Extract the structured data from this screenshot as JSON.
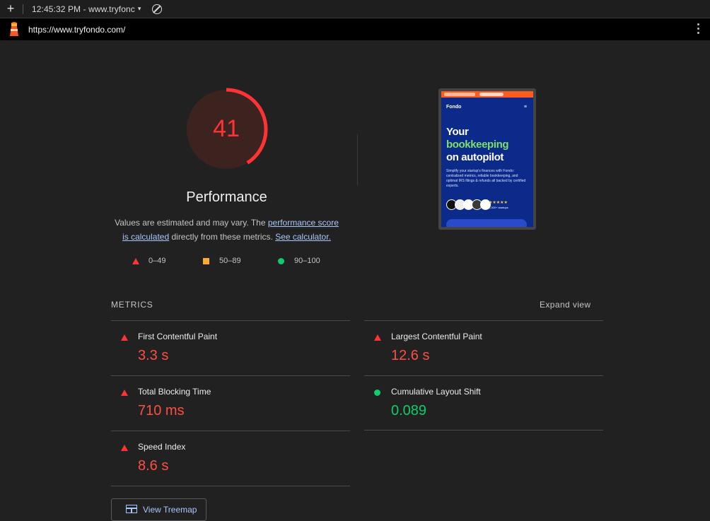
{
  "browser": {
    "new_tab_glyph": "+",
    "tab_title": "12:45:32 PM - www.tryfonc",
    "tab_menu_glyph": "▾",
    "url": "https://www.tryfondo.com/"
  },
  "report": {
    "score": "41",
    "score_fraction": 0.41,
    "category_title": "Performance",
    "description": {
      "prefix": "Values are estimated and may vary. The ",
      "link1": "performance score is calculated",
      "middle": " directly from these metrics. ",
      "link2": "See calculator."
    },
    "legend": [
      {
        "label": "0–49",
        "shape": "triangle",
        "color": "#ff3333"
      },
      {
        "label": "50–89",
        "shape": "square",
        "color": "#ffaa33"
      },
      {
        "label": "90–100",
        "shape": "circle",
        "color": "#0cce6b"
      }
    ],
    "colors": {
      "fail": "#ff4e42",
      "pass": "#0cce6b",
      "link": "#a8c7fa"
    }
  },
  "screenshot": {
    "brand": "Fondo",
    "menu_glyph": "≡",
    "headline_1": "Your",
    "headline_2": "bookkeeping",
    "headline_3": "on autopilot",
    "subtext": "Simplify your startup's finances with Fondo: centralized metrics, reliable bookkeeping, and optimal IRS filings & refunds all backed by certified experts.",
    "rating_stars": "★★★★★",
    "startups_count": "1,000+ startups"
  },
  "metrics": {
    "section_label": "METRICS",
    "expand_label": "Expand view",
    "items": [
      {
        "name": "First Contentful Paint",
        "value": "3.3 s",
        "status": "fail"
      },
      {
        "name": "Largest Contentful Paint",
        "value": "12.6 s",
        "status": "fail"
      },
      {
        "name": "Total Blocking Time",
        "value": "710 ms",
        "status": "fail"
      },
      {
        "name": "Cumulative Layout Shift",
        "value": "0.089",
        "status": "pass"
      },
      {
        "name": "Speed Index",
        "value": "8.6 s",
        "status": "fail"
      }
    ]
  },
  "treemap_button": "View Treemap"
}
